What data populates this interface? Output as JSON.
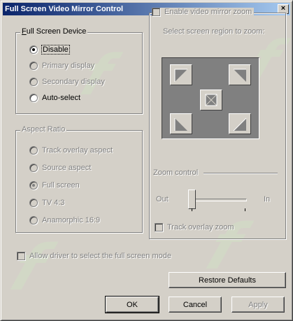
{
  "window": {
    "title": "Full Screen Video Mirror Control",
    "close_glyph": "×"
  },
  "device_group": {
    "title": "Full Screen Device",
    "options": [
      {
        "label": "Disable",
        "checked": true,
        "enabled": true
      },
      {
        "label": "Primary display",
        "checked": false,
        "enabled": false
      },
      {
        "label": "Secondary display",
        "checked": false,
        "enabled": false
      },
      {
        "label": "Auto-select",
        "checked": false,
        "enabled": true
      }
    ]
  },
  "aspect_group": {
    "title": "Aspect Ratio",
    "options": [
      {
        "label": "Track overlay aspect",
        "checked": false
      },
      {
        "label": "Source aspect",
        "checked": false
      },
      {
        "label": "Full screen",
        "checked": true
      },
      {
        "label": "TV 4:3",
        "checked": false
      },
      {
        "label": "Anamorphic 16:9",
        "checked": false
      }
    ]
  },
  "zoom_group": {
    "enable_label": "Enable video mirror zoom",
    "region_label": "Select screen region to zoom:",
    "zoom_control_label": "Zoom control",
    "out_label": "Out",
    "in_label": "In",
    "track_label": "Track overlay zoom",
    "slider_value": 0.0
  },
  "allow_driver_label": "Allow driver to select the full screen mode",
  "buttons": {
    "restore": "Restore Defaults",
    "ok": "OK",
    "cancel": "Cancel",
    "apply": "Apply"
  }
}
